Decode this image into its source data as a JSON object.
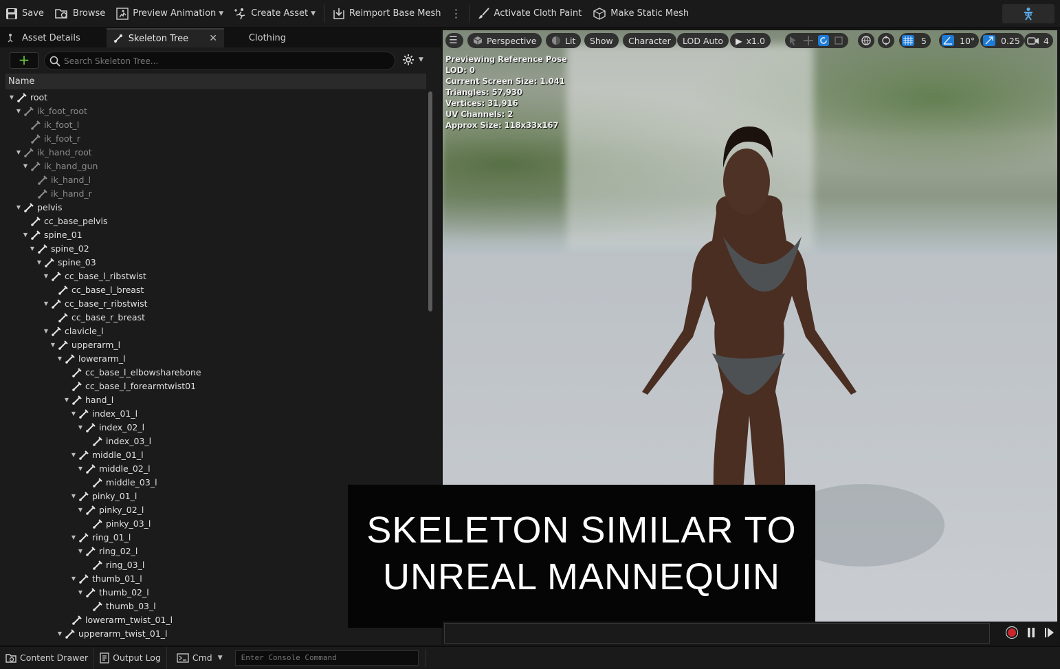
{
  "toolbar": {
    "save": "Save",
    "browse": "Browse",
    "preview_animation": "Preview Animation",
    "create_asset": "Create Asset",
    "reimport": "Reimport Base Mesh",
    "cloth_paint": "Activate Cloth Paint",
    "static_mesh": "Make Static Mesh"
  },
  "tabs": {
    "asset_details": "Asset Details",
    "skeleton_tree": "Skeleton Tree",
    "clothing": "Clothing"
  },
  "search": {
    "placeholder": "Search Skeleton Tree..."
  },
  "tree_header": "Name",
  "tree": [
    {
      "label": "root",
      "depth": 0,
      "exp": true,
      "dim": false
    },
    {
      "label": "ik_foot_root",
      "depth": 1,
      "exp": true,
      "dim": true
    },
    {
      "label": "ik_foot_l",
      "depth": 2,
      "exp": false,
      "dim": true
    },
    {
      "label": "ik_foot_r",
      "depth": 2,
      "exp": false,
      "dim": true
    },
    {
      "label": "ik_hand_root",
      "depth": 1,
      "exp": true,
      "dim": true
    },
    {
      "label": "ik_hand_gun",
      "depth": 2,
      "exp": true,
      "dim": true
    },
    {
      "label": "ik_hand_l",
      "depth": 3,
      "exp": false,
      "dim": true
    },
    {
      "label": "ik_hand_r",
      "depth": 3,
      "exp": false,
      "dim": true
    },
    {
      "label": "pelvis",
      "depth": 1,
      "exp": true,
      "dim": false
    },
    {
      "label": "cc_base_pelvis",
      "depth": 2,
      "exp": false,
      "dim": false
    },
    {
      "label": "spine_01",
      "depth": 2,
      "exp": true,
      "dim": false
    },
    {
      "label": "spine_02",
      "depth": 3,
      "exp": true,
      "dim": false
    },
    {
      "label": "spine_03",
      "depth": 4,
      "exp": true,
      "dim": false
    },
    {
      "label": "cc_base_l_ribstwist",
      "depth": 5,
      "exp": true,
      "dim": false
    },
    {
      "label": "cc_base_l_breast",
      "depth": 6,
      "exp": false,
      "dim": false
    },
    {
      "label": "cc_base_r_ribstwist",
      "depth": 5,
      "exp": true,
      "dim": false
    },
    {
      "label": "cc_base_r_breast",
      "depth": 6,
      "exp": false,
      "dim": false
    },
    {
      "label": "clavicle_l",
      "depth": 5,
      "exp": true,
      "dim": false
    },
    {
      "label": "upperarm_l",
      "depth": 6,
      "exp": true,
      "dim": false
    },
    {
      "label": "lowerarm_l",
      "depth": 7,
      "exp": true,
      "dim": false
    },
    {
      "label": "cc_base_l_elbowsharebone",
      "depth": 8,
      "exp": false,
      "dim": false
    },
    {
      "label": "cc_base_l_forearmtwist01",
      "depth": 8,
      "exp": false,
      "dim": false
    },
    {
      "label": "hand_l",
      "depth": 8,
      "exp": true,
      "dim": false
    },
    {
      "label": "index_01_l",
      "depth": 9,
      "exp": true,
      "dim": false
    },
    {
      "label": "index_02_l",
      "depth": 10,
      "exp": true,
      "dim": false
    },
    {
      "label": "index_03_l",
      "depth": 11,
      "exp": false,
      "dim": false
    },
    {
      "label": "middle_01_l",
      "depth": 9,
      "exp": true,
      "dim": false
    },
    {
      "label": "middle_02_l",
      "depth": 10,
      "exp": true,
      "dim": false
    },
    {
      "label": "middle_03_l",
      "depth": 11,
      "exp": false,
      "dim": false
    },
    {
      "label": "pinky_01_l",
      "depth": 9,
      "exp": true,
      "dim": false
    },
    {
      "label": "pinky_02_l",
      "depth": 10,
      "exp": true,
      "dim": false
    },
    {
      "label": "pinky_03_l",
      "depth": 11,
      "exp": false,
      "dim": false
    },
    {
      "label": "ring_01_l",
      "depth": 9,
      "exp": true,
      "dim": false
    },
    {
      "label": "ring_02_l",
      "depth": 10,
      "exp": true,
      "dim": false
    },
    {
      "label": "ring_03_l",
      "depth": 11,
      "exp": false,
      "dim": false
    },
    {
      "label": "thumb_01_l",
      "depth": 9,
      "exp": true,
      "dim": false
    },
    {
      "label": "thumb_02_l",
      "depth": 10,
      "exp": true,
      "dim": false
    },
    {
      "label": "thumb_03_l",
      "depth": 11,
      "exp": false,
      "dim": false
    },
    {
      "label": "lowerarm_twist_01_l",
      "depth": 8,
      "exp": false,
      "dim": false
    },
    {
      "label": "upperarm_twist_01_l",
      "depth": 7,
      "exp": true,
      "dim": false
    }
  ],
  "viewport": {
    "perspective": "Perspective",
    "lit": "Lit",
    "show": "Show",
    "character": "Character",
    "lod": "LOD Auto",
    "speed": "x1.0",
    "grid_snap": "5",
    "rot_snap": "10°",
    "scale_snap": "0.25",
    "camera_speed": "4",
    "stats": [
      "Previewing Reference Pose",
      "LOD: 0",
      "Current Screen Size: 1.041",
      "Triangles: 57,930",
      "Vertices: 31,916",
      "UV Channels: 2",
      "Approx Size: 118x33x167"
    ]
  },
  "overlay": {
    "line1": "SKELETON SIMILAR TO",
    "line2": "UNREAL MANNEQUIN"
  },
  "statusbar": {
    "content_drawer": "Content Drawer",
    "output_log": "Output Log",
    "cmd": "Cmd",
    "console_placeholder": "Enter Console Command"
  },
  "colors": {
    "accent_green": "#6cc644",
    "accent_blue": "#1e7bd6",
    "record_red": "#c8282d"
  }
}
